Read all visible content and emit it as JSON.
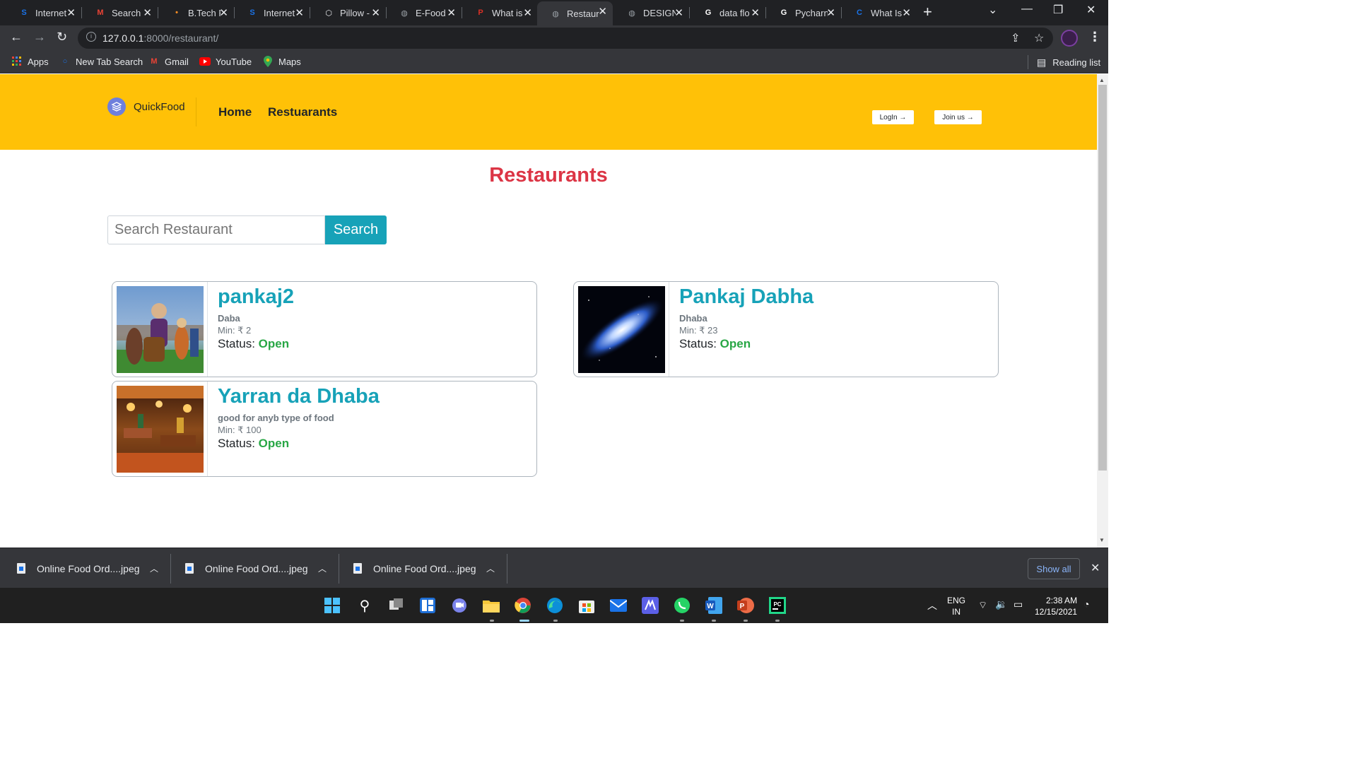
{
  "browser": {
    "tabs": [
      {
        "title": "Internet",
        "favicon": "s-icon",
        "color": "#1a73e8",
        "glyph": "S"
      },
      {
        "title": "Search",
        "favicon": "gmail-icon",
        "color": "#ea4335",
        "glyph": "M"
      },
      {
        "title": "B.Tech F",
        "favicon": "btech-icon",
        "color": "#f28b22",
        "glyph": "•"
      },
      {
        "title": "Internet",
        "favicon": "s-icon",
        "color": "#1a73e8",
        "glyph": "S"
      },
      {
        "title": "Pillow -",
        "favicon": "pillow-icon",
        "color": "#e8eaed",
        "glyph": "⬡"
      },
      {
        "title": "E-Food",
        "favicon": "globe-icon",
        "color": "#9aa0a6",
        "glyph": "◍"
      },
      {
        "title": "What is",
        "favicon": "p-icon",
        "color": "#d93025",
        "glyph": "P"
      },
      {
        "title": "Restaur",
        "favicon": "globe-icon",
        "color": "#9aa0a6",
        "glyph": "◍",
        "active": true
      },
      {
        "title": "DESIGN",
        "favicon": "globe-icon",
        "color": "#9aa0a6",
        "glyph": "◍"
      },
      {
        "title": "data flo",
        "favicon": "google-icon",
        "color": "#ffffff",
        "glyph": "G"
      },
      {
        "title": "Pycharn",
        "favicon": "google-icon",
        "color": "#ffffff",
        "glyph": "G"
      },
      {
        "title": "What Is",
        "favicon": "c-icon",
        "color": "#1a73e8",
        "glyph": "C"
      }
    ],
    "url_host": "127.0.0.1",
    "url_path": ":8000/restaurant/",
    "bookmarks": [
      {
        "label": "Apps",
        "icon": "apps-grid-icon"
      },
      {
        "label": "New Tab Search",
        "icon": "search-icon"
      },
      {
        "label": "Gmail",
        "icon": "gmail-icon"
      },
      {
        "label": "YouTube",
        "icon": "youtube-icon"
      },
      {
        "label": "Maps",
        "icon": "maps-pin-icon"
      }
    ],
    "reading_list": "Reading list"
  },
  "site": {
    "brand": "QuickFood",
    "nav": [
      "Home",
      "Restuarants"
    ],
    "login_label": "LogIn →",
    "join_label": "Join us →",
    "accent_color": "#ffc107"
  },
  "page": {
    "title": "Restaurants",
    "search_placeholder": "Search Restaurant",
    "search_button": "Search"
  },
  "restaurants": [
    {
      "name": "pankaj2",
      "description": "Daba",
      "min": "Min: ₹ 2",
      "status_label": "Status: ",
      "status": "Open",
      "image": "cartoon-characters-image"
    },
    {
      "name": "Pankaj Dabha",
      "description": "Dhaba",
      "min": "Min: ₹ 23",
      "status_label": "Status: ",
      "status": "Open",
      "image": "galaxy-image"
    },
    {
      "name": "Yarran da Dhaba",
      "description": "good for anyb type of food",
      "min": "Min: ₹ 100",
      "status_label": "Status: ",
      "status": "Open",
      "image": "restaurant-interior-image"
    }
  ],
  "downloads": {
    "items": [
      "Online Food Ord....jpeg",
      "Online Food Ord....jpeg",
      "Online Food Ord....jpeg"
    ],
    "show_all": "Show all"
  },
  "taskbar": {
    "lang": "ENG",
    "region": "IN",
    "time": "2:38 AM",
    "date": "12/15/2021"
  }
}
